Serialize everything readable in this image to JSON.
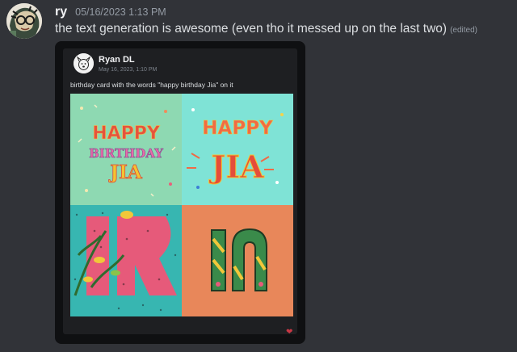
{
  "message": {
    "username": "ry",
    "timestamp": "05/16/2023 1:13 PM",
    "text": "the text generation is awesome (even tho it messed up on the last two)",
    "edited_label": "(edited)"
  },
  "attachment": {
    "author": "Ryan DL",
    "date": "May 16, 2023, 1:10 PM",
    "prompt": "birthday card with the words \"happy birthday Jia\" on it",
    "images": [
      {
        "line1": "HAPPY",
        "line2": "BIRTHDAY",
        "line3": "JIA"
      },
      {
        "line1": "HAPPY",
        "line2": "JIA"
      }
    ],
    "reaction_icon": "heart-icon"
  }
}
